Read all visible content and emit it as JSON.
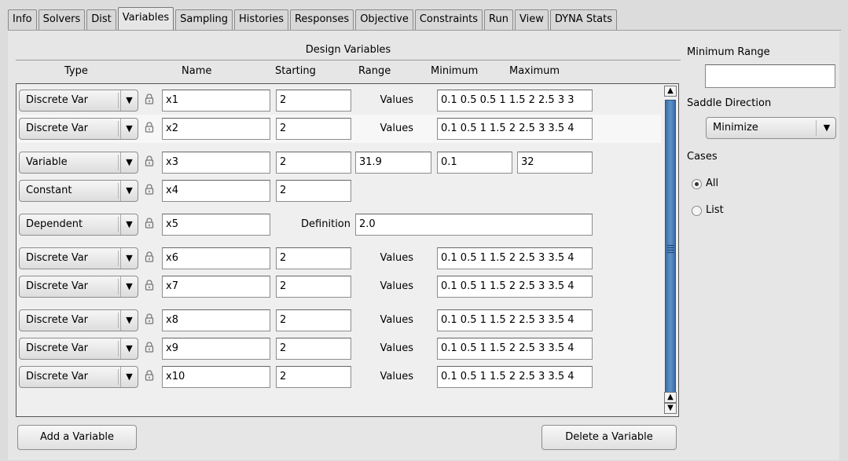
{
  "tabs": [
    "Info",
    "Solvers",
    "Dist",
    "Variables",
    "Sampling",
    "Histories",
    "Responses",
    "Objective",
    "Constraints",
    "Run",
    "View",
    "DYNA Stats"
  ],
  "active_tab": "Variables",
  "design_variables": {
    "title": "Design Variables",
    "columns": {
      "type": "Type",
      "name": "Name",
      "starting": "Starting",
      "range": "Range",
      "minimum": "Minimum",
      "maximum": "Maximum"
    },
    "rows": [
      {
        "type": "Discrete Var",
        "name": "x1",
        "starting": "2",
        "label": "Values",
        "values": "0.1 0.5 0.5 1 1.5 2 2.5 3 3"
      },
      {
        "type": "Discrete Var",
        "name": "x2",
        "starting": "2",
        "label": "Values",
        "values": "0.1 0.5 1 1.5 2 2.5 3 3.5 4"
      },
      {
        "type": "Variable",
        "name": "x3",
        "starting": "2",
        "range": "31.9",
        "minimum": "0.1",
        "maximum": "32"
      },
      {
        "type": "Constant",
        "name": "x4",
        "starting": "2"
      },
      {
        "type": "Dependent",
        "name": "x5",
        "label": "Definition",
        "definition": "2.0"
      },
      {
        "type": "Discrete Var",
        "name": "x6",
        "starting": "2",
        "label": "Values",
        "values": "0.1 0.5 1 1.5 2 2.5 3 3.5 4"
      },
      {
        "type": "Discrete Var",
        "name": "x7",
        "starting": "2",
        "label": "Values",
        "values": "0.1 0.5 1 1.5 2 2.5 3 3.5 4"
      },
      {
        "type": "Discrete Var",
        "name": "x8",
        "starting": "2",
        "label": "Values",
        "values": "0.1 0.5 1 1.5 2 2.5 3 3.5 4"
      },
      {
        "type": "Discrete Var",
        "name": "x9",
        "starting": "2",
        "label": "Values",
        "values": "0.1 0.5 1 1.5 2 2.5 3 3.5 4"
      },
      {
        "type": "Discrete Var",
        "name": "x10",
        "starting": "2",
        "label": "Values",
        "values": "0.1 0.5 1 1.5 2 2.5 3 3.5 4"
      }
    ]
  },
  "buttons": {
    "add": "Add a Variable",
    "delete": "Delete a Variable"
  },
  "side": {
    "minimum_range_label": "Minimum Range",
    "minimum_range_value": "",
    "saddle_label": "Saddle Direction",
    "saddle_value": "Minimize",
    "cases_label": "Cases",
    "cases_options": [
      "All",
      "List"
    ],
    "cases_selected": "All"
  },
  "icons": {
    "lock": "lock-icon",
    "combo_arrow": "chevron-down-icon",
    "scroll_up": "arrow-up-icon",
    "scroll_down": "arrow-down-icon"
  },
  "colors": {
    "scroll_thumb": "#4a7db8",
    "background": "#dcdcdc"
  }
}
